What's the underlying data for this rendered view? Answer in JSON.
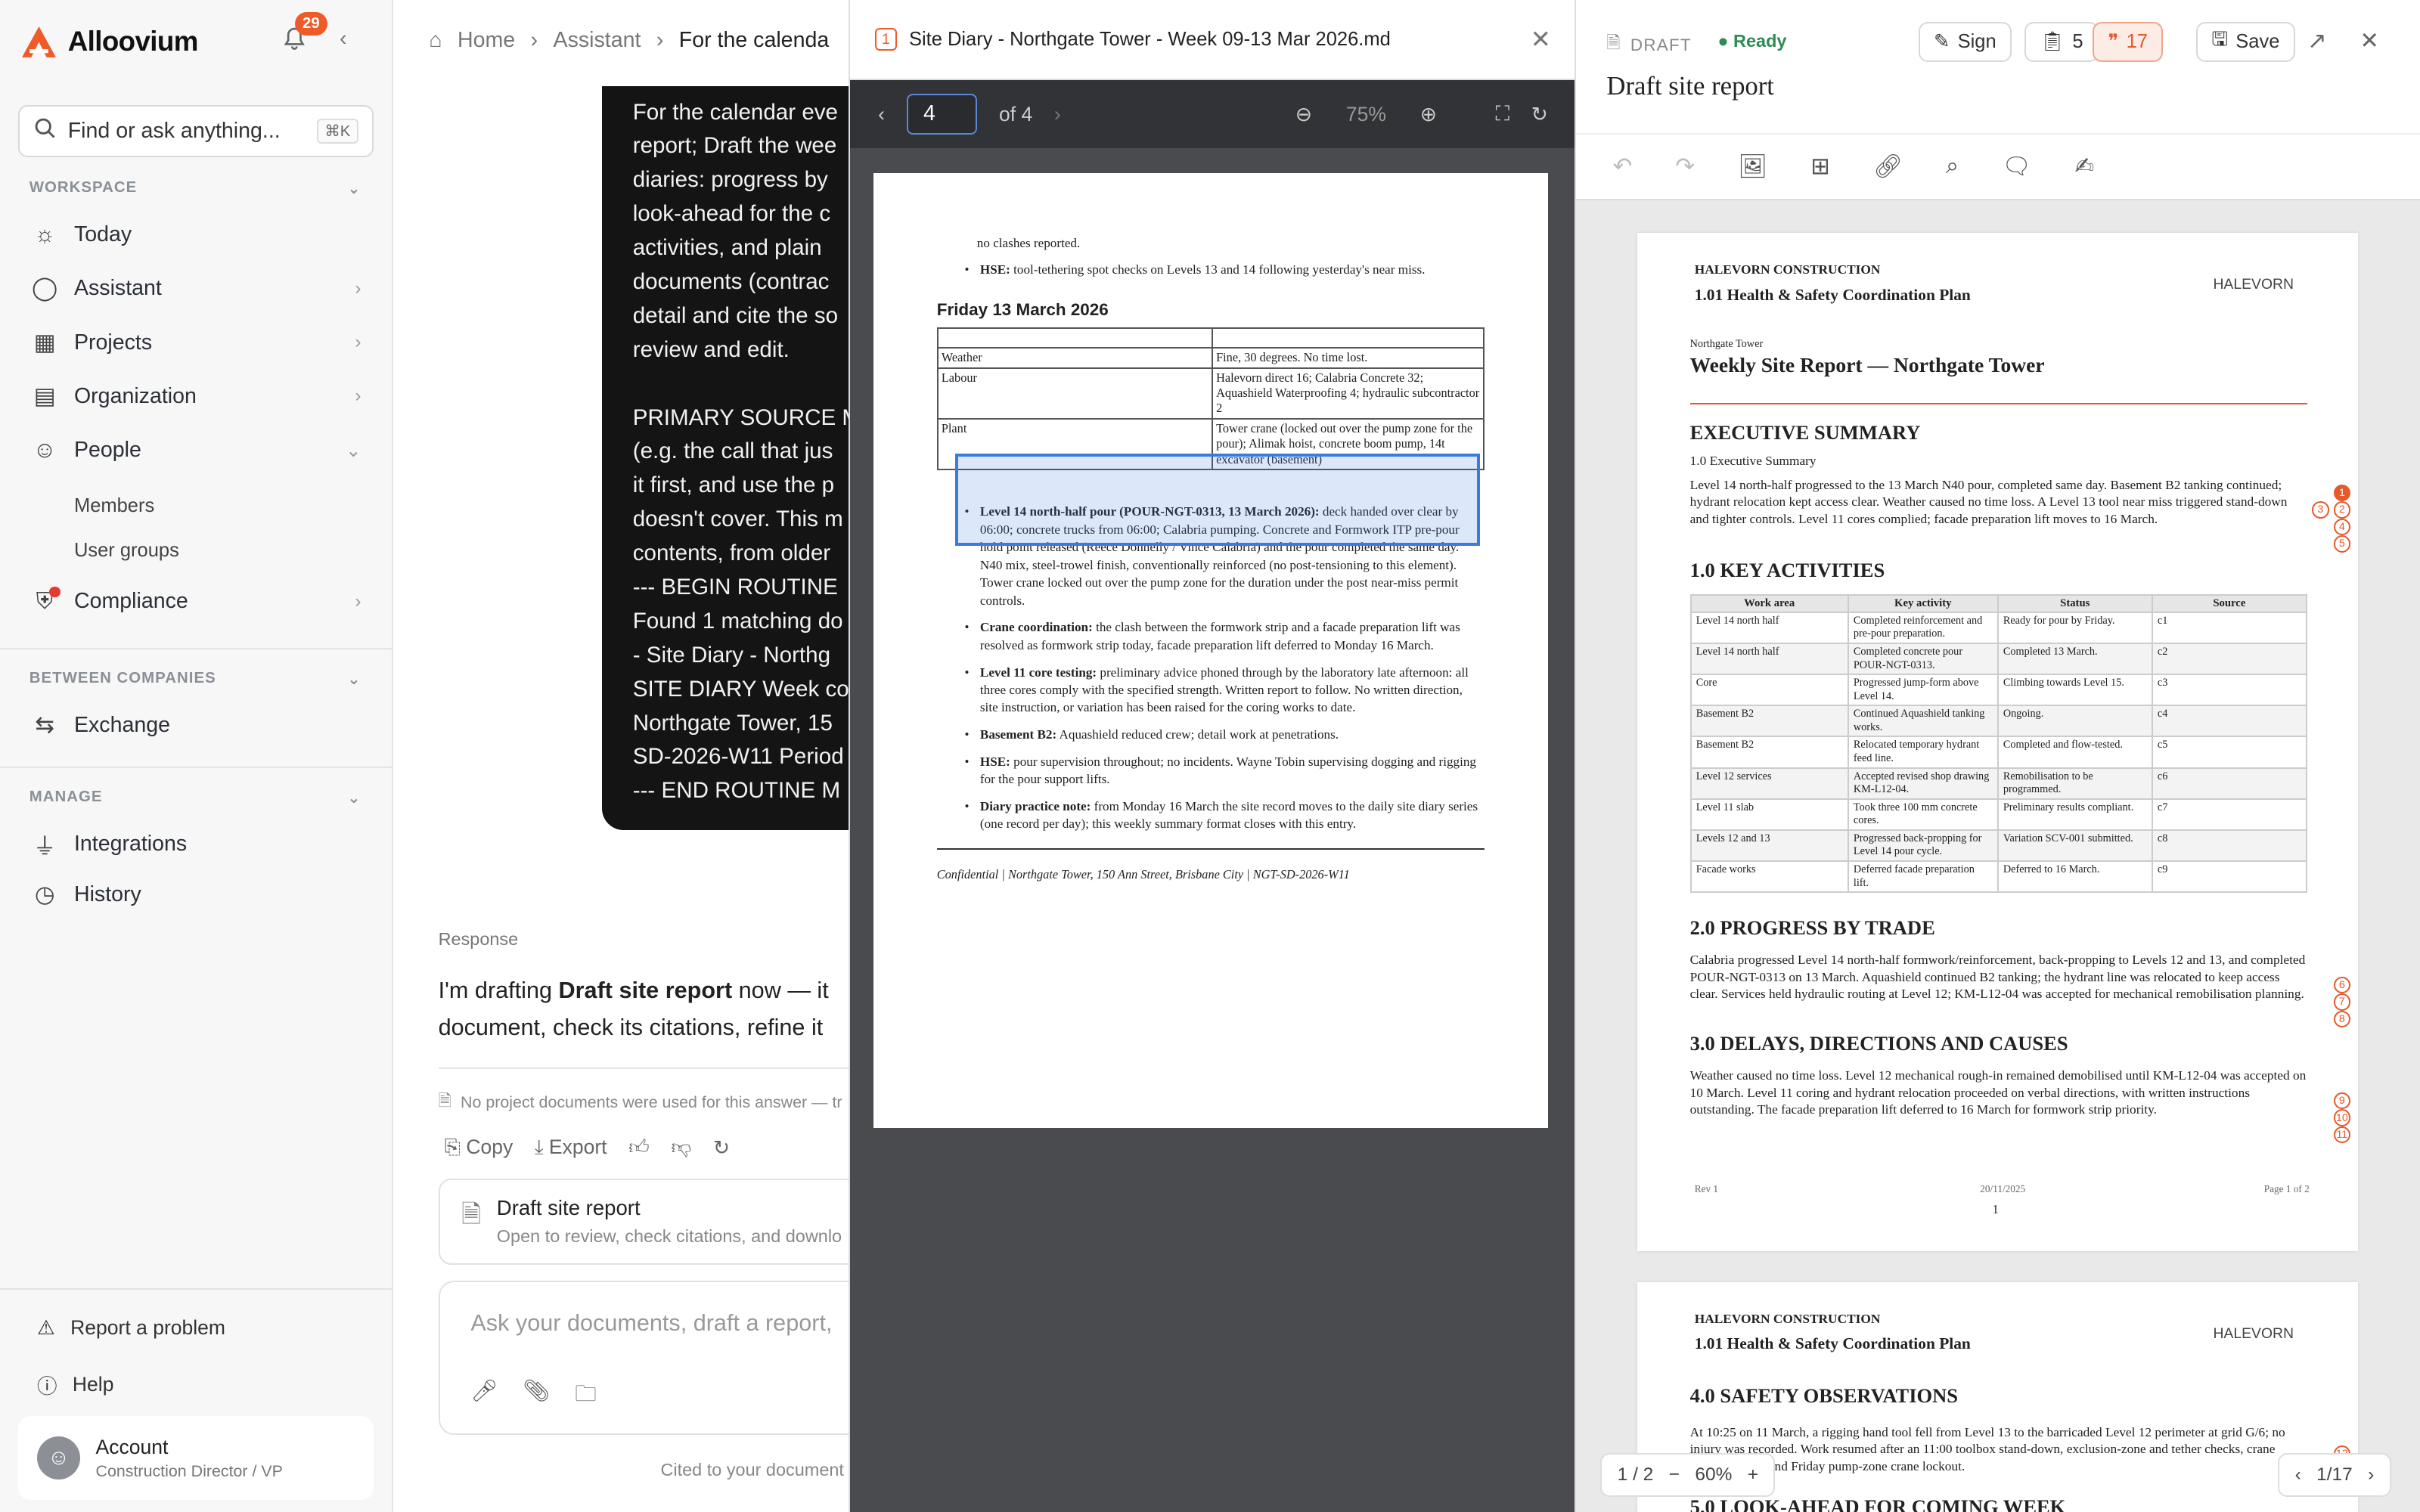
{
  "app": {
    "name": "Alloovium",
    "notifications": "29"
  },
  "search": {
    "placeholder": "Find or ask anything...",
    "shortcut": "⌘K"
  },
  "sidebar": {
    "workspace": "WORKSPACE",
    "between": "BETWEEN COMPANIES",
    "manage": "MANAGE",
    "items": [
      {
        "label": "Today"
      },
      {
        "label": "Assistant"
      },
      {
        "label": "Projects"
      },
      {
        "label": "Organization"
      },
      {
        "label": "People"
      },
      {
        "label": "Compliance"
      },
      {
        "label": "Exchange"
      },
      {
        "label": "Integrations"
      },
      {
        "label": "History"
      }
    ],
    "people_sub": [
      "Members",
      "User groups"
    ],
    "report": "Report a problem",
    "help": "Help",
    "account": {
      "name": "Account",
      "role": "Construction Director / VP"
    }
  },
  "breadcrumb": [
    "Home",
    "Assistant",
    "For the calenda"
  ],
  "message": "For the calendar eve\nreport; Draft the wee\ndiaries: progress by\nlook-ahead for the c\nactivities, and plain\ndocuments (contrac\ndetail and cite the so\nreview and edit.\n\nPRIMARY SOURCE M\n(e.g. the call that jus\nit first, and use the p\ndoesn't cover. This m\ncontents, from older\n--- BEGIN ROUTINE\nFound 1 matching do\n- Site Diary - Northg\nSITE DIARY Week co\nNorthgate Tower, 15\nSD-2026-W11 Period\n--- END ROUTINE M",
  "response": {
    "label": "Response",
    "pre": "I'm drafting ",
    "bold": "Draft site report",
    "post": " now — it",
    "line2": "document, check its citations, refine it"
  },
  "note": "No project documents were used for this answer — tr",
  "actions": [
    "Copy",
    "Export"
  ],
  "card": {
    "title": "Draft site report",
    "sub": "Open to review, check citations, and downlo"
  },
  "composer": {
    "placeholder": "Ask your documents, draft a report,"
  },
  "cited": "Cited to your document",
  "pdf": {
    "cite": "1",
    "title": "Site Diary - Northgate Tower - Week 09-13 Mar 2026.md",
    "page": "4",
    "of": "of 4",
    "zoom": "75%",
    "top_line": "no clashes reported.",
    "hse1": {
      "b": "HSE:",
      "t": " tool-tethering spot checks on Levels 13 and 14 following yesterday's near miss."
    },
    "day": "Friday 13 March 2026",
    "table": [
      [
        "",
        ""
      ],
      [
        "Weather",
        "Fine, 30 degrees. No time lost."
      ],
      [
        "Labour",
        "Halevorn direct 16; Calabria Concrete 32; Aquashield Waterproofing 4; hydraulic subcontractor 2"
      ],
      [
        "Plant",
        "Tower crane (locked out over the pump zone for the pour); Alimak hoist, concrete boom pump, 14t excavator (basement)"
      ]
    ],
    "bullets": [
      {
        "b": "Level 14 north-half pour (POUR-NGT-0313, 13 March 2026):",
        "t": " deck handed over clear by 06:00; concrete trucks from 06:00; Calabria pumping. Concrete and Formwork ITP pre-pour hold point released (Reece Donnelly / Vince Calabria) and the pour completed the same day. N40 mix, steel-trowel finish, conventionally reinforced (no post-tensioning to this element). Tower crane locked out over the pump zone for the duration under the post near-miss permit controls."
      },
      {
        "b": "Crane coordination:",
        "t": " the clash between the formwork strip and a facade preparation lift was resolved as formwork strip today, facade preparation lift deferred to Monday 16 March."
      },
      {
        "b": "Level 11 core testing:",
        "t": " preliminary advice phoned through by the laboratory late afternoon: all three cores comply with the specified strength. Written report to follow. No written direction, site instruction, or variation has been raised for the coring works to date."
      },
      {
        "b": "Basement B2:",
        "t": " Aquashield reduced crew; detail work at penetrations."
      },
      {
        "b": "HSE:",
        "t": " pour supervision throughout; no incidents. Wayne Tobin supervising dogging and rigging for the pour support lifts."
      },
      {
        "b": "Diary practice note:",
        "t": " from Monday 16 March the site record moves to the daily site diary series (one record per day); this weekly summary format closes with this entry."
      }
    ],
    "footer": "Confidential | Northgate Tower, 150 Ann Street, Brisbane City | NGT-SD-2026-W11"
  },
  "editor": {
    "draft": "DRAFT",
    "ready": "Ready",
    "title": "Draft site report",
    "sign": "Sign",
    "count1": "5",
    "count2": "17",
    "save": "Save",
    "page1": {
      "company": "HALEVORN CONSTRUCTION",
      "plan": "1.01 Health & Safety Coordination Plan",
      "brand": "HALEVORN",
      "project": "Northgate Tower",
      "title": "Weekly Site Report — Northgate Tower",
      "h_exec": "EXECUTIVE SUMMARY",
      "sub_exec": "1.0 Executive Summary",
      "exec": "Level 14 north-half progressed to the 13 March N40 pour, completed same day. Basement B2 tanking continued; hydrant relocation kept access clear. Weather caused no time loss. A Level 13 tool near miss triggered stand-down and tighter controls. Level 11 cores complied; facade preparation lift moves to 16 March.",
      "h_key": "1.0 KEY ACTIVITIES",
      "cols": [
        "Work area",
        "Key activity",
        "Status",
        "Source"
      ],
      "rows": [
        [
          "Level 14 north half",
          "Completed reinforcement and pre-pour preparation.",
          "Ready for pour by Friday.",
          "c1"
        ],
        [
          "Level 14 north half",
          "Completed concrete pour POUR-NGT-0313.",
          "Completed 13 March.",
          "c2"
        ],
        [
          "Core",
          "Progressed jump-form above Level 14.",
          "Climbing towards Level 15.",
          "c3"
        ],
        [
          "Basement B2",
          "Continued Aquashield tanking works.",
          "Ongoing.",
          "c4"
        ],
        [
          "Basement B2",
          "Relocated temporary hydrant feed line.",
          "Completed and flow-tested.",
          "c5"
        ],
        [
          "Level 12 services",
          "Accepted revised shop drawing KM-L12-04.",
          "Remobilisation to be programmed.",
          "c6"
        ],
        [
          "Level 11 slab",
          "Took three 100 mm concrete cores.",
          "Preliminary results compliant.",
          "c7"
        ],
        [
          "Levels 12 and 13",
          "Progressed back-propping for Level 14 pour cycle.",
          "Variation SCV-001 submitted.",
          "c8"
        ],
        [
          "Facade works",
          "Deferred facade preparation lift.",
          "Deferred to 16 March.",
          "c9"
        ]
      ],
      "h_prog": "2.0 PROGRESS BY TRADE",
      "prog": "Calabria progressed Level 14 north-half formwork/reinforcement, back-propping to Levels 12 and 13, and completed POUR-NGT-0313 on 13 March. Aquashield continued B2 tanking; the hydrant line was relocated to keep access clear. Services held hydraulic routing at Level 12; KM-L12-04 was accepted for mechanical remobilisation planning.",
      "h_delay": "3.0 DELAYS, DIRECTIONS AND CAUSES",
      "delay": "Weather caused no time loss. Level 12 mechanical rough-in remained demobilised until KM-L12-04 was accepted on 10 March. Level 11 coring and hydrant relocation proceeded on verbal directions, with written instructions outstanding. The facade preparation lift deferred to 16 March for formwork strip priority.",
      "rev": "Rev 1",
      "date": "20/11/2025",
      "pg": "Page 1 of 2",
      "num": "1",
      "cites": [
        "1",
        "2",
        "3",
        "4",
        "5",
        "6",
        "7",
        "8",
        "9",
        "10",
        "11"
      ]
    },
    "page2": {
      "company": "HALEVORN CONSTRUCTION",
      "plan": "1.01 Health & Safety Coordination Plan",
      "brand": "HALEVORN",
      "h_safety": "4.0 SAFETY OBSERVATIONS",
      "safety": "At 10:25 on 11 March, a rigging hand tool fell from Level 13 to the barricaded Level 12 perimeter at grid G/6; no injury was recorded. Work resumed after an 11:00 toolbox stand-down, exclusion-zone and tether checks, crane permit review, and Friday pump-zone crane lockout.",
      "h_look": "5.0 LOOK-AHEAD FOR COMING WEEK",
      "cites": [
        "12",
        "13"
      ]
    },
    "page_ind": "1 / 2",
    "zoom": "60%",
    "pager": "1/17"
  }
}
